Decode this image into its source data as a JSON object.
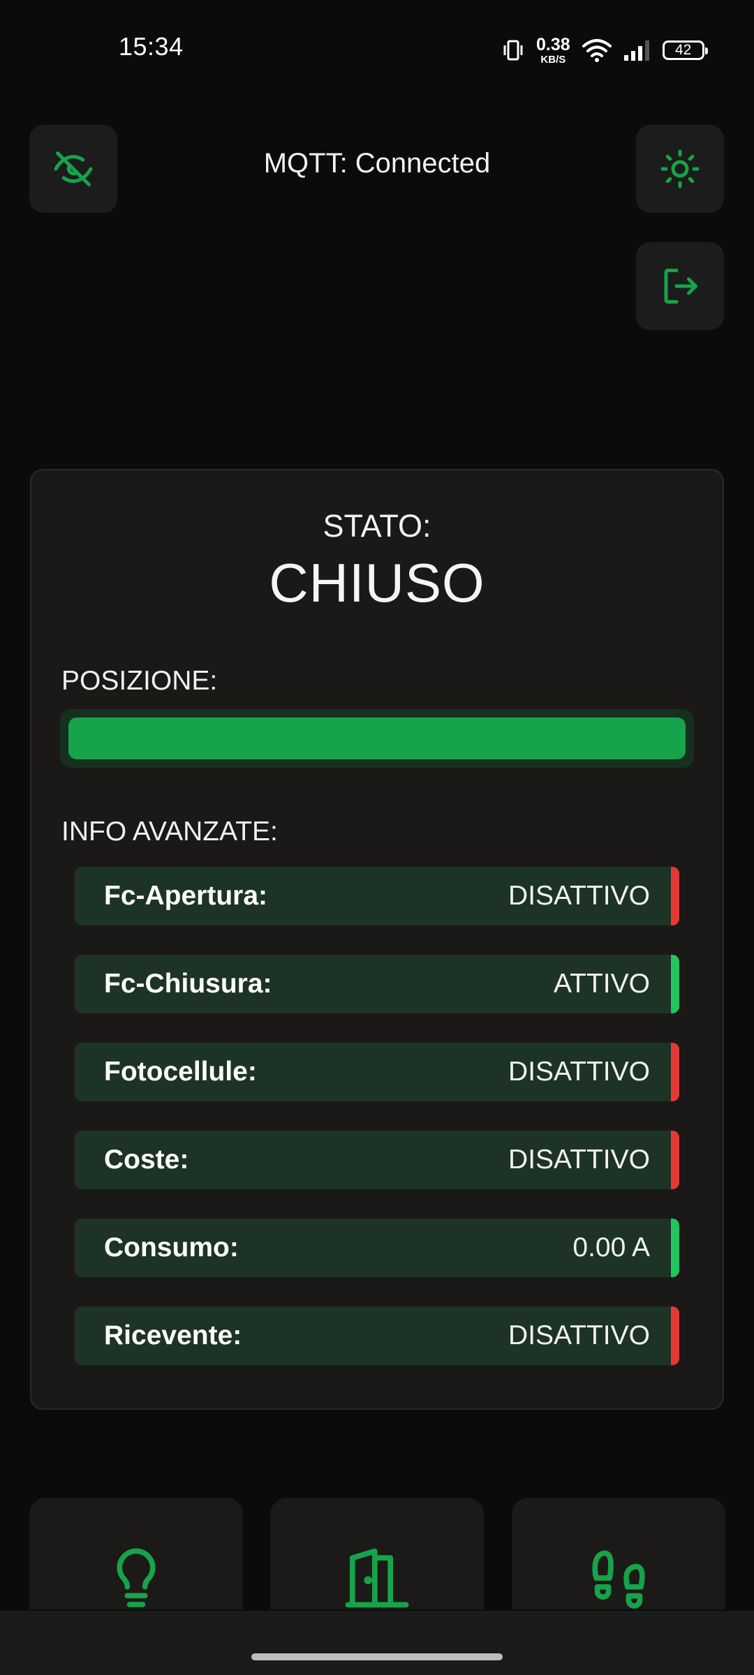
{
  "status_bar": {
    "time": "15:34",
    "net_speed": "0.38",
    "net_unit": "KB/S",
    "battery": "42"
  },
  "header": {
    "mqtt_status": "MQTT: Connected",
    "left_button_icon": "eye-off-icon",
    "settings_icon": "sun-icon",
    "logout_icon": "logout-icon"
  },
  "card": {
    "stato_label": "STATO:",
    "stato_value": "CHIUSO",
    "posizione_label": "POSIZIONE:",
    "posizione_percent": 100,
    "info_label": "INFO AVANZATE:",
    "rows": [
      {
        "label": "Fc-Apertura:",
        "value": "DISATTIVO",
        "indicator": "#e53935"
      },
      {
        "label": "Fc-Chiusura:",
        "value": "ATTIVO",
        "indicator": "#22c55e"
      },
      {
        "label": "Fotocellule:",
        "value": "DISATTIVO",
        "indicator": "#e53935"
      },
      {
        "label": "Coste:",
        "value": "DISATTIVO",
        "indicator": "#e53935"
      },
      {
        "label": "Consumo:",
        "value": "0.00 A",
        "indicator": "#22c55e"
      },
      {
        "label": "Ricevente:",
        "value": "DISATTIVO",
        "indicator": "#e53935"
      }
    ]
  },
  "bottom_tiles": [
    {
      "icon": "lightbulb-icon"
    },
    {
      "icon": "door-icon"
    },
    {
      "icon": "footsteps-icon"
    }
  ],
  "colors": {
    "accent": "#17a34a",
    "background": "#0b0b0b",
    "card": "#1b1918",
    "row_bg": "#1d3326",
    "active": "#22c55e",
    "inactive": "#e53935"
  }
}
